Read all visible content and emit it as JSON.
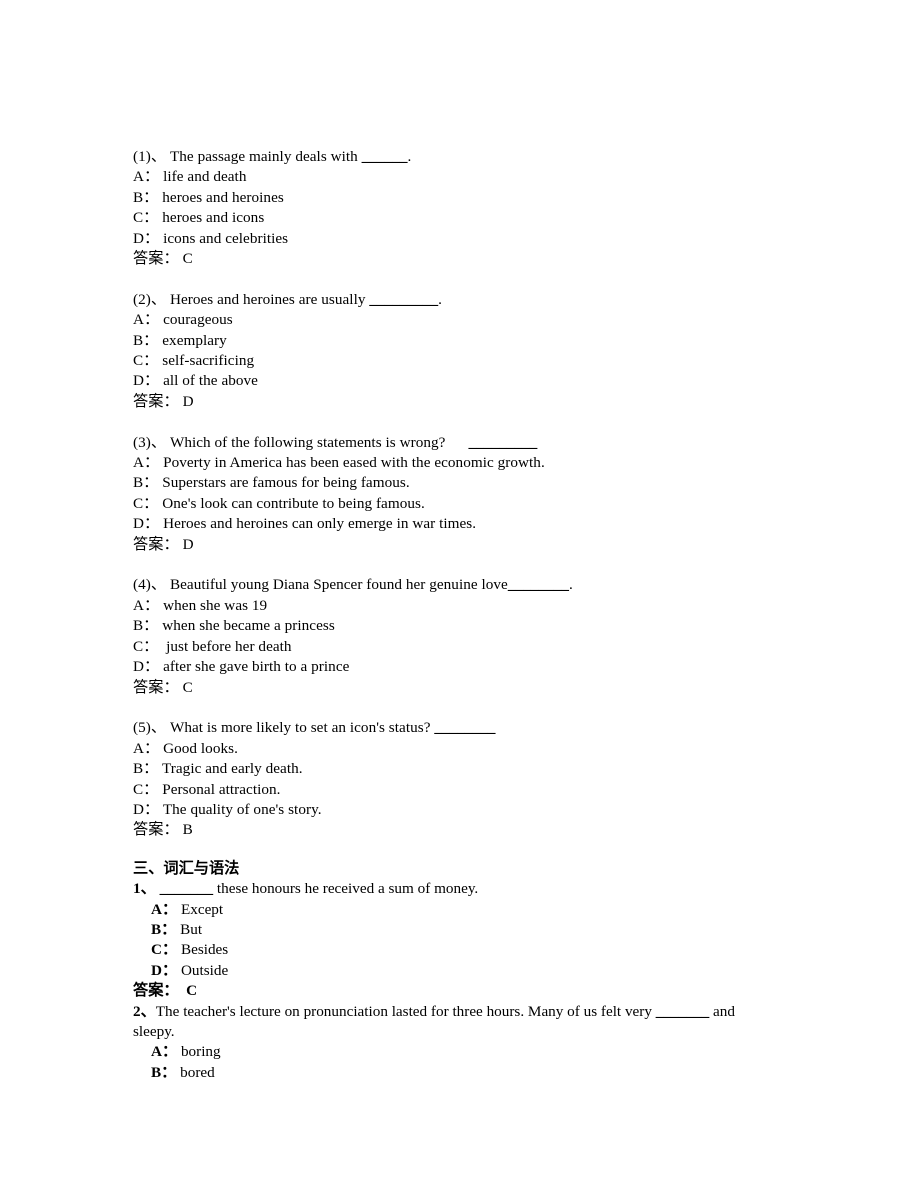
{
  "reading_section": {
    "questions": [
      {
        "number": "(1)、",
        "stem_before_blank": " The passage mainly deals with ",
        "blank": "______",
        "stem_after_blank": ".",
        "options": [
          {
            "letter": "A：",
            "text": " life and death"
          },
          {
            "letter": "B：",
            "text": " heroes and heroines"
          },
          {
            "letter": "C：",
            "text": " heroes and icons"
          },
          {
            "letter": "D：",
            "text": " icons and celebrities"
          }
        ],
        "answer_label": "答案：",
        "answer_value": " C"
      },
      {
        "number": "(2)、",
        "stem_before_blank": " Heroes and heroines are usually ",
        "blank": "_________",
        "stem_after_blank": ".",
        "options": [
          {
            "letter": "A：",
            "text": " courageous"
          },
          {
            "letter": "B：",
            "text": " exemplary"
          },
          {
            "letter": "C：",
            "text": " self-sacrificing"
          },
          {
            "letter": "D：",
            "text": " all of the above"
          }
        ],
        "answer_label": "答案：",
        "answer_value": " D"
      },
      {
        "number": "(3)、",
        "stem_before_blank": " Which of the following statements is wrong?      ",
        "blank": "_________",
        "stem_after_blank": "",
        "options": [
          {
            "letter": "A：",
            "text": " Poverty in America has been eased with the economic growth."
          },
          {
            "letter": "B：",
            "text": " Superstars are famous for being famous."
          },
          {
            "letter": "C：",
            "text": " One's look can contribute to being famous."
          },
          {
            "letter": "D：",
            "text": " Heroes and heroines can only emerge in war times."
          }
        ],
        "answer_label": "答案：",
        "answer_value": " D"
      },
      {
        "number": "(4)、",
        "stem_before_blank": " Beautiful young Diana Spencer found her genuine love",
        "blank": "________",
        "stem_after_blank": ".",
        "options": [
          {
            "letter": "A：",
            "text": " when she was 19"
          },
          {
            "letter": "B：",
            "text": " when she became a princess"
          },
          {
            "letter": "C：",
            "text": "  just before her death"
          },
          {
            "letter": "D：",
            "text": " after she gave birth to a prince"
          }
        ],
        "answer_label": "答案：",
        "answer_value": " C"
      },
      {
        "number": "(5)、",
        "stem_before_blank": " What is more likely to set an icon's status? ",
        "blank": "________",
        "stem_after_blank": "",
        "options": [
          {
            "letter": "A：",
            "text": " Good looks."
          },
          {
            "letter": "B：",
            "text": " Tragic and early death."
          },
          {
            "letter": "C：",
            "text": " Personal attraction."
          },
          {
            "letter": "D：",
            "text": " The quality of one's story."
          }
        ],
        "answer_label": "答案：",
        "answer_value": " B"
      }
    ]
  },
  "vocab_section": {
    "heading": "三、词汇与语法",
    "questions": [
      {
        "number": "1、",
        "stem_before_blank": " ",
        "blank": "_______",
        "stem_after_blank": " these honours he received a sum of money.",
        "wrap_text": "",
        "options": [
          {
            "letter": "A：",
            "text": " Except"
          },
          {
            "letter": "B：",
            "text": " But"
          },
          {
            "letter": "C：",
            "text": " Besides"
          },
          {
            "letter": "D：",
            "text": " Outside"
          }
        ],
        "answer_label": "答案：",
        "answer_value": "  C"
      },
      {
        "number": "2、",
        "stem_before_blank": "The teacher's lecture on pronunciation lasted for three hours. Many of us felt very ",
        "blank": "_______",
        "stem_after_blank": " and",
        "wrap_text": "sleepy.",
        "options": [
          {
            "letter": "A：",
            "text": " boring"
          },
          {
            "letter": "B：",
            "text": " bored"
          }
        ],
        "answer_label": "",
        "answer_value": ""
      }
    ]
  }
}
